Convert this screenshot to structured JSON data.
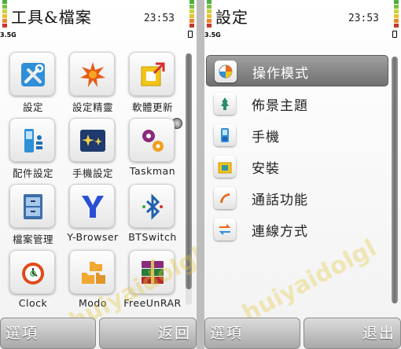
{
  "left_screen": {
    "title": "工具&檔案",
    "clock": "23:53",
    "network": "3.5G",
    "apps": [
      {
        "label": "設定",
        "icon": "tools-icon"
      },
      {
        "label": "設定精靈",
        "icon": "settings-wizard-icon"
      },
      {
        "label": "軟體更新",
        "icon": "software-update-icon"
      },
      {
        "label": "配件設定",
        "icon": "accessory-settings-icon"
      },
      {
        "label": "手機設定",
        "icon": "phone-setup-icon"
      },
      {
        "label": "Taskman",
        "icon": "taskman-icon"
      },
      {
        "label": "檔案管理",
        "icon": "file-manager-icon"
      },
      {
        "label": "Y-Browser",
        "icon": "y-browser-icon"
      },
      {
        "label": "BTSwitch",
        "icon": "bluetooth-icon"
      },
      {
        "label": "Clock",
        "icon": "alarm-clock-icon"
      },
      {
        "label": "Modo",
        "icon": "folder-icon"
      },
      {
        "label": "FreeUnRAR",
        "icon": "winrar-icon"
      }
    ],
    "softkeys": {
      "left": "選項",
      "right": "返回"
    }
  },
  "right_screen": {
    "title": "設定",
    "clock": "23:53",
    "network": "3.5G",
    "items": [
      {
        "label": "操作模式",
        "icon": "profiles-icon",
        "selected": true
      },
      {
        "label": "佈景主題",
        "icon": "themes-icon",
        "selected": false
      },
      {
        "label": "手機",
        "icon": "phone-icon",
        "selected": false
      },
      {
        "label": "安裝",
        "icon": "installation-icon",
        "selected": false
      },
      {
        "label": "通話功能",
        "icon": "call-icon",
        "selected": false
      },
      {
        "label": "連線方式",
        "icon": "connectivity-icon",
        "selected": false
      }
    ],
    "softkeys": {
      "left": "選項",
      "right": "退出"
    }
  },
  "watermark": "huiyaidolgl"
}
